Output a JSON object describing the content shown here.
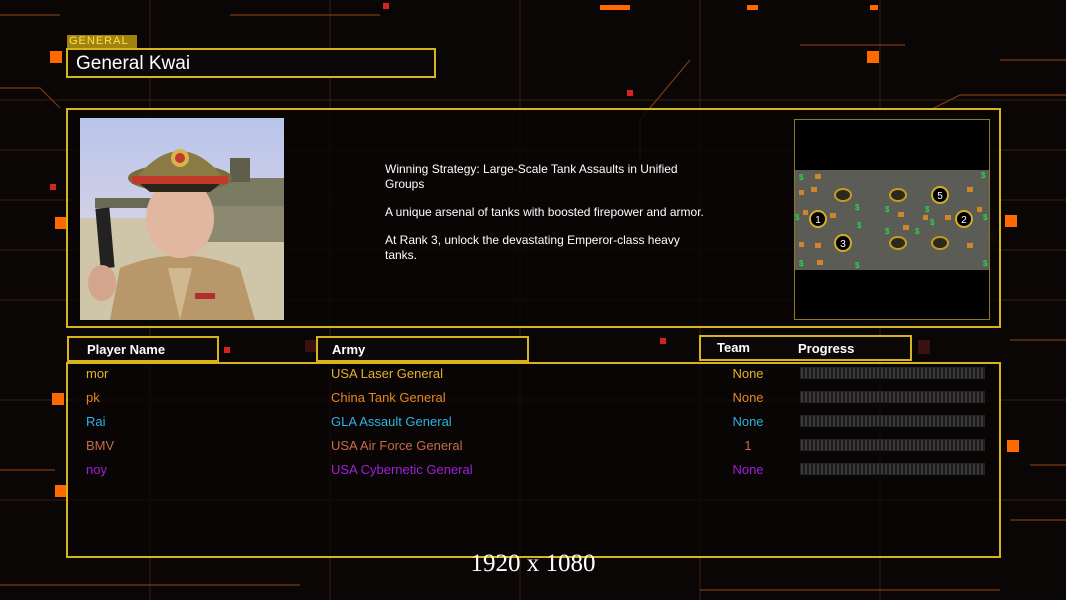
{
  "general_tag": "GENERAL",
  "general_name": "General Kwai",
  "description": [
    "Winning Strategy: Large-Scale Tank Assaults in Unified Groups",
    "A unique arsenal of tanks with boosted firepower and armor.",
    "At Rank 3, unlock the devastating Emperor-class heavy tanks."
  ],
  "map": {
    "start_positions": [
      "1",
      "2",
      "3",
      "5"
    ]
  },
  "headers": {
    "player_name": "Player Name",
    "army": "Army",
    "team": "Team",
    "progress": "Progress"
  },
  "players": [
    {
      "name": "mor",
      "army": "USA Laser General",
      "team": "None",
      "color": "#e3b12c",
      "progress": 0
    },
    {
      "name": "pk",
      "army": "China Tank General",
      "team": "None",
      "color": "#e7861f",
      "progress": 0
    },
    {
      "name": "Rai",
      "army": "GLA Assault General",
      "team": "None",
      "color": "#2fb2de",
      "progress": 0
    },
    {
      "name": "BMV",
      "army": "USA Air Force General",
      "team": "1",
      "color": "#c86a4a",
      "progress": 0
    },
    {
      "name": "noy",
      "army": "USA Cybernetic General",
      "team": "None",
      "color": "#a020d8",
      "progress": 0
    }
  ],
  "resolution_label": "1920 x 1080",
  "colors": {
    "accent": "#d6b41a",
    "background": "#0b0606",
    "circuit": "#ff6a00"
  }
}
